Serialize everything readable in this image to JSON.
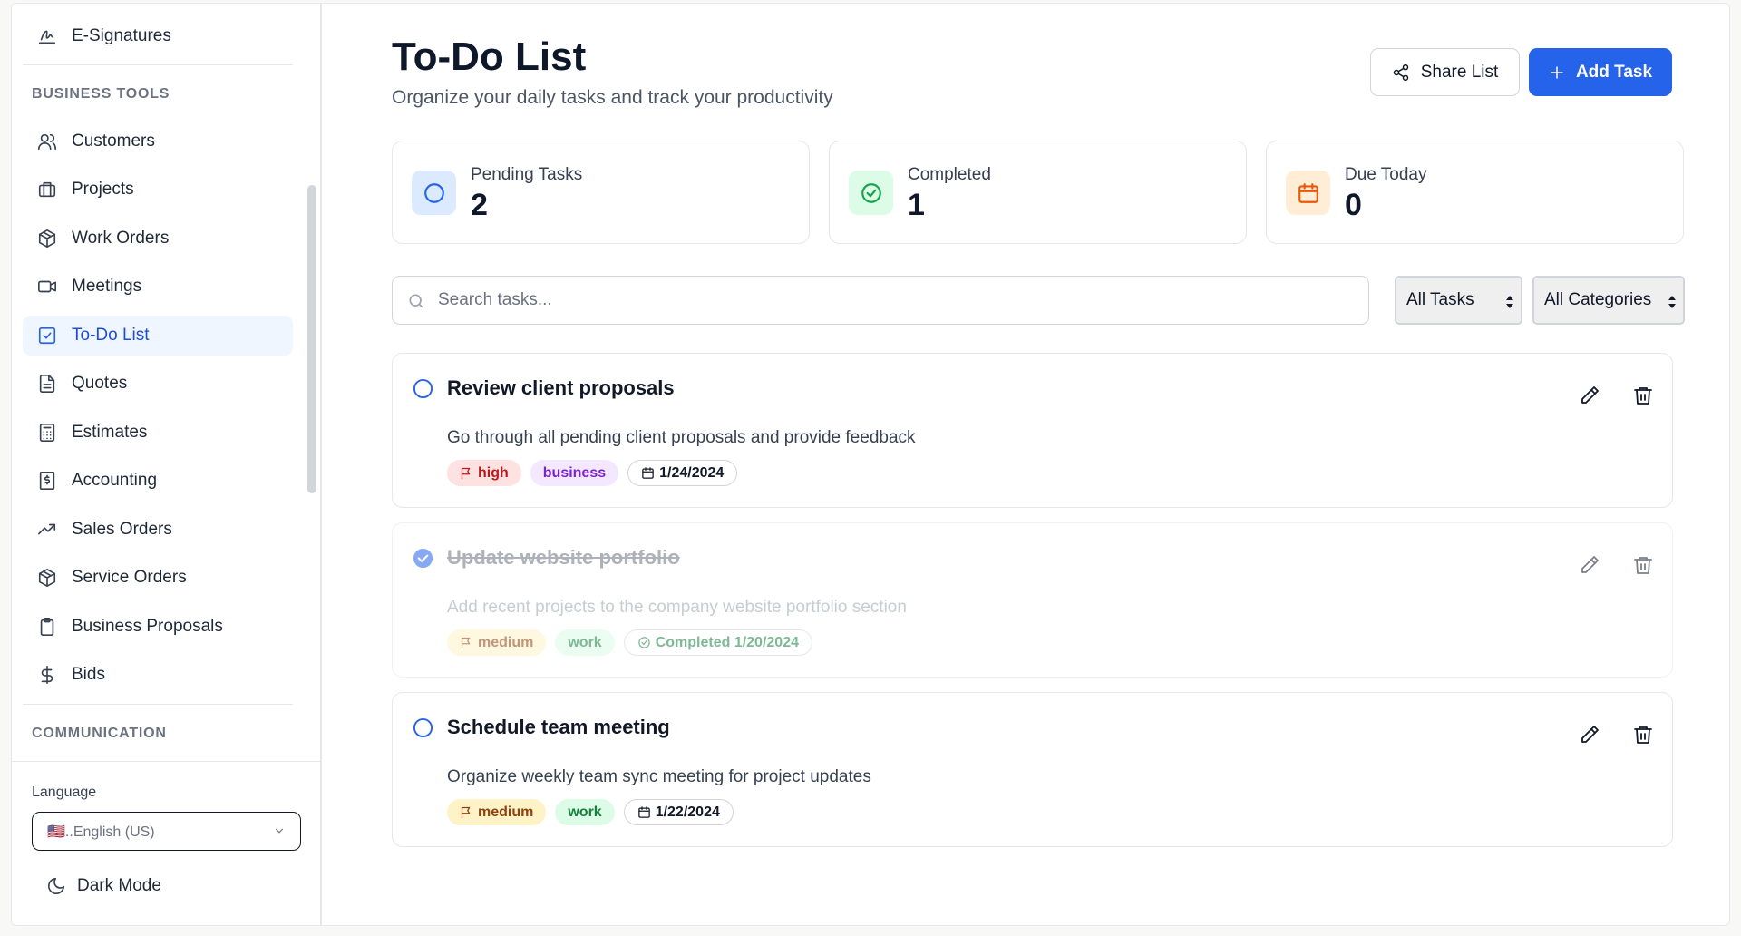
{
  "sidebar": {
    "top_item": "E-Signatures",
    "section_business": "BUSINESS TOOLS",
    "items": [
      {
        "label": "Customers",
        "icon": "users-icon"
      },
      {
        "label": "Projects",
        "icon": "briefcase-icon"
      },
      {
        "label": "Work Orders",
        "icon": "package-icon"
      },
      {
        "label": "Meetings",
        "icon": "video-icon"
      },
      {
        "label": "To-Do List",
        "icon": "check-square-icon",
        "active": true
      },
      {
        "label": "Quotes",
        "icon": "file-text-icon"
      },
      {
        "label": "Estimates",
        "icon": "calculator-icon"
      },
      {
        "label": "Accounting",
        "icon": "receipt-icon"
      },
      {
        "label": "Sales Orders",
        "icon": "trending-up-icon"
      },
      {
        "label": "Service Orders",
        "icon": "package-icon"
      },
      {
        "label": "Business Proposals",
        "icon": "clipboard-icon"
      },
      {
        "label": "Bids",
        "icon": "dollar-icon"
      }
    ],
    "section_communication": "COMMUNICATION",
    "language_label": "Language",
    "language_value": "🇺🇸..English (US)",
    "dark_mode": "Dark Mode"
  },
  "header": {
    "title": "To-Do List",
    "subtitle": "Organize your daily tasks and track your productivity",
    "share_label": "Share List",
    "add_label": "Add Task"
  },
  "stats": [
    {
      "label": "Pending Tasks",
      "value": "2"
    },
    {
      "label": "Completed",
      "value": "1"
    },
    {
      "label": "Due Today",
      "value": "0"
    }
  ],
  "filters": {
    "search_placeholder": "Search tasks...",
    "status_selected": "All Tasks",
    "category_selected": "All Categories"
  },
  "tasks": [
    {
      "title": "Review client proposals",
      "description": "Go through all pending client proposals and provide feedback",
      "priority": "high",
      "category": "business",
      "date": "1/24/2024",
      "completed": false
    },
    {
      "title": "Update website portfolio",
      "description": "Add recent projects to the company website portfolio section",
      "priority": "medium",
      "category": "work",
      "date": "Completed 1/20/2024",
      "completed": true
    },
    {
      "title": "Schedule team meeting",
      "description": "Organize weekly team sync meeting for project updates",
      "priority": "medium",
      "category": "work",
      "date": "1/22/2024",
      "completed": false
    }
  ],
  "colors": {
    "accent": "#2563eb",
    "active_nav_bg": "#eff6ff"
  }
}
